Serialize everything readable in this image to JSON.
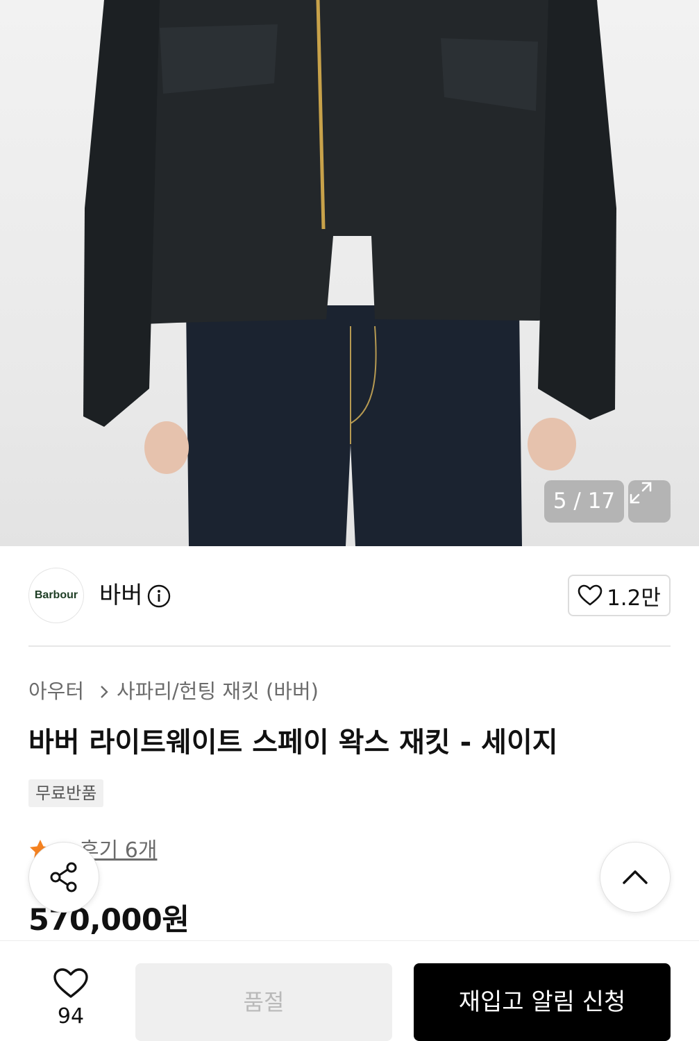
{
  "gallery": {
    "counter": "5 / 17",
    "expand_icon": "expand-icon"
  },
  "brand": {
    "logo_text": "Barbour",
    "name": "바버",
    "info_icon": "info-icon",
    "follower_count": "1.2만"
  },
  "breadcrumb": {
    "level1": "아우터",
    "level2": "사파리/헌팅 재킷 (바버)"
  },
  "product": {
    "title": "바버 라이트웨이트 스페이 왁스 재킷 - 세이지",
    "badge": "무료반품",
    "review_link": "후기 6개",
    "price": "570,000원"
  },
  "floating": {
    "share_icon": "share-icon",
    "scroll_top_icon": "chevron-up-icon"
  },
  "bottom_bar": {
    "like_count": "94",
    "soldout_label": "품절",
    "restock_label": "재입고 알림 신청"
  },
  "colors": {
    "accent_star": "#f58220",
    "primary_button": "#000000",
    "disabled_button": "#efefef"
  }
}
